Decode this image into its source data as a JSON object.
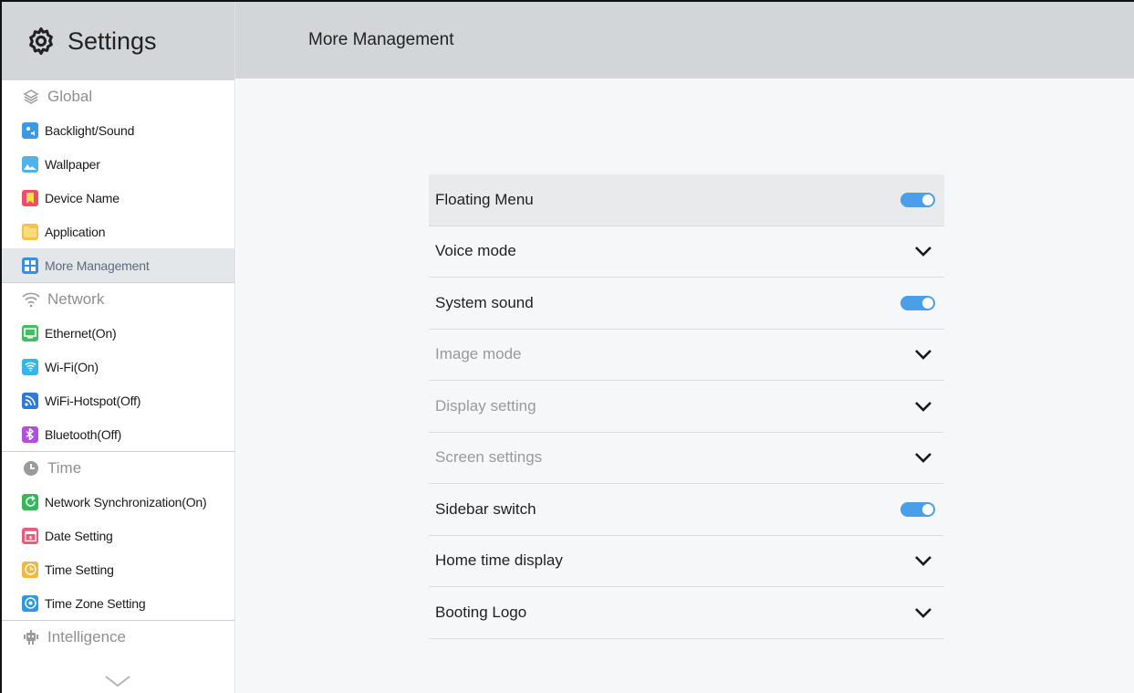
{
  "app": {
    "title": "Settings"
  },
  "header": {
    "title": "More Management"
  },
  "sidebar": {
    "sections": [
      {
        "label": "Global",
        "icon": "layers-icon",
        "items": [
          {
            "label": "Backlight/Sound",
            "icon": "backlight-sound-icon",
            "color": "#3a9ae6"
          },
          {
            "label": "Wallpaper",
            "icon": "wallpaper-icon",
            "color": "#4fb3ea"
          },
          {
            "label": "Device Name",
            "icon": "bookmark-icon",
            "color": "#ef4b6b"
          },
          {
            "label": "Application",
            "icon": "folder-icon",
            "color": "#f2c24a"
          },
          {
            "label": "More Management",
            "icon": "grid-icon",
            "color": "#3a8fe0",
            "active": true
          }
        ]
      },
      {
        "label": "Network",
        "icon": "wifi-icon",
        "items": [
          {
            "label": "Ethernet(On)",
            "icon": "monitor-icon",
            "color": "#3fbf5f"
          },
          {
            "label": "Wi-Fi(On)",
            "icon": "wifi-icon",
            "color": "#35b6e6"
          },
          {
            "label": "WiFi-Hotspot(Off)",
            "icon": "hotspot-icon",
            "color": "#2f7ad8"
          },
          {
            "label": "Bluetooth(Off)",
            "icon": "bluetooth-icon",
            "color": "#b34fe0"
          }
        ]
      },
      {
        "label": "Time",
        "icon": "clock-icon",
        "items": [
          {
            "label": "Network Synchronization(On)",
            "icon": "sync-icon",
            "color": "#36b85a"
          },
          {
            "label": "Date Setting",
            "icon": "calendar-icon",
            "color": "#ee5b7a"
          },
          {
            "label": "Time Setting",
            "icon": "clock-icon",
            "color": "#f2b73c"
          },
          {
            "label": "Time Zone Setting",
            "icon": "location-icon",
            "color": "#2f98e0"
          }
        ]
      },
      {
        "label": "Intelligence",
        "icon": "robot-icon",
        "items": []
      }
    ]
  },
  "settings_list": [
    {
      "label": "Floating Menu",
      "control": "toggle",
      "on": true,
      "highlight": true,
      "disabled": false
    },
    {
      "label": "Voice mode",
      "control": "chevron",
      "disabled": false
    },
    {
      "label": "System sound",
      "control": "toggle",
      "on": true,
      "disabled": false
    },
    {
      "label": "Image mode",
      "control": "chevron",
      "disabled": true
    },
    {
      "label": "Display setting",
      "control": "chevron",
      "disabled": true
    },
    {
      "label": "Screen settings",
      "control": "chevron",
      "disabled": true
    },
    {
      "label": "Sidebar switch",
      "control": "toggle",
      "on": true,
      "disabled": false
    },
    {
      "label": "Home time display",
      "control": "chevron",
      "disabled": false
    },
    {
      "label": "Booting Logo",
      "control": "chevron",
      "disabled": false
    }
  ],
  "colors": {
    "toggle_on": "#4a9fe8",
    "header_bg": "#d3d6d8",
    "main_bg": "#f5f7f9",
    "active_item_text": "#5a6b80"
  }
}
